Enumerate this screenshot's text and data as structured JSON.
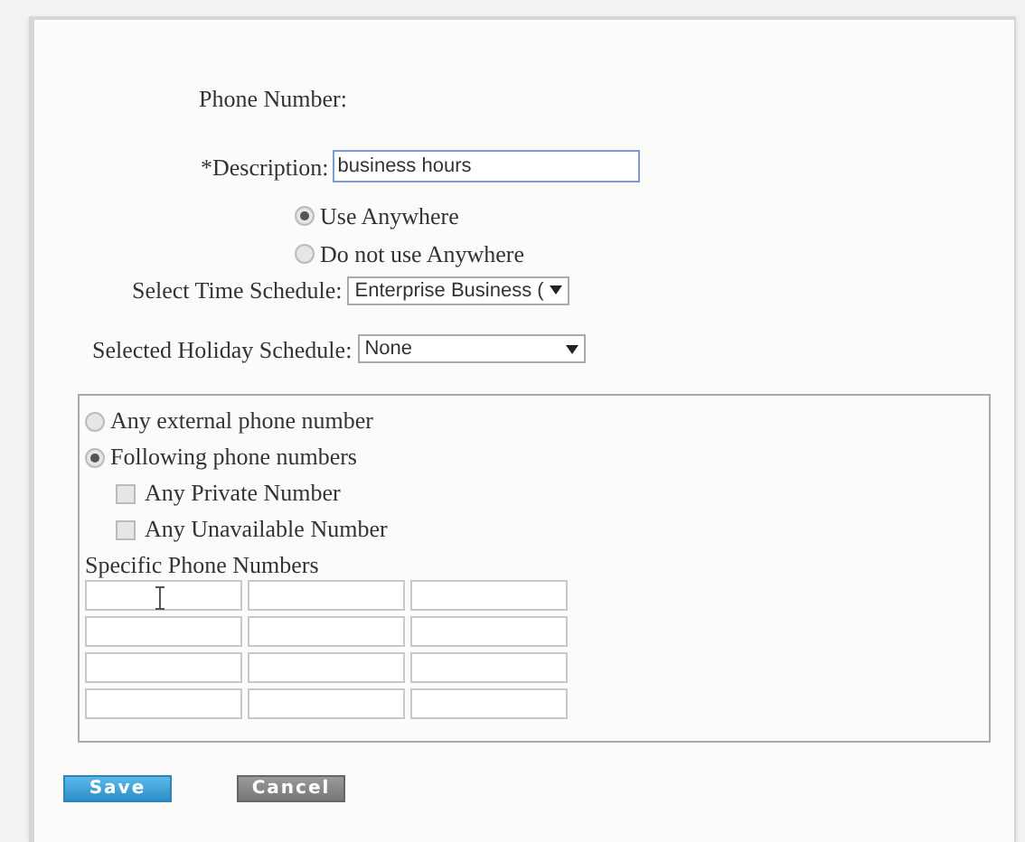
{
  "phone_number": {
    "label": "Phone Number:"
  },
  "description": {
    "label": "*Description:",
    "value": "business hours"
  },
  "usage_options": [
    {
      "label": "Use Anywhere",
      "selected": true
    },
    {
      "label": "Do not use Anywhere",
      "selected": false
    }
  ],
  "time_schedule": {
    "label": "Select Time Schedule:",
    "value": "Enterprise Business ("
  },
  "holiday_schedule": {
    "label": "Selected Holiday Schedule:",
    "value": "None"
  },
  "caller_options": [
    {
      "label": "Any external phone number",
      "selected": false
    },
    {
      "label": "Following phone numbers",
      "selected": true
    }
  ],
  "number_filters": [
    {
      "label": "Any Private Number",
      "checked": false
    },
    {
      "label": "Any Unavailable Number",
      "checked": false
    }
  ],
  "specific_numbers": {
    "label": "Specific Phone Numbers",
    "rows": [
      {
        "fields": [
          {
            "kind": "input",
            "cursor": true
          },
          {
            "kind": "input"
          },
          {
            "kind": "input"
          }
        ]
      },
      {
        "fields": [
          {
            "kind": "input"
          },
          {
            "kind": "input"
          },
          {
            "kind": "input"
          }
        ]
      },
      {
        "fields": [
          {
            "kind": "input"
          },
          {
            "kind": "input"
          },
          {
            "kind": "input"
          }
        ]
      },
      {
        "fields": [
          {
            "kind": "input"
          },
          {
            "kind": "input"
          },
          {
            "kind": "input"
          }
        ]
      }
    ]
  },
  "buttons": [
    {
      "label": "Save",
      "kind": "primary"
    },
    {
      "label": "Cancel",
      "kind": "secondary"
    }
  ]
}
